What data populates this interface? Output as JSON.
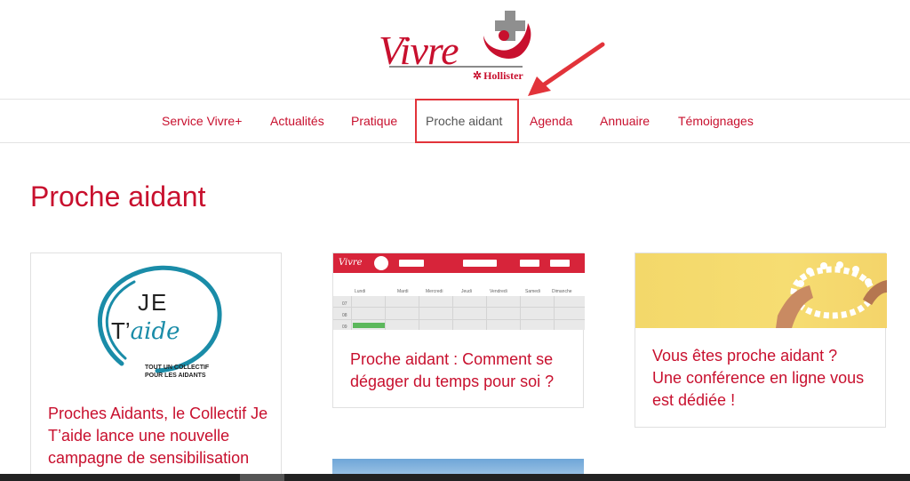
{
  "logo": {
    "text": "Vivre",
    "sub": "Hollister",
    "star": "✲"
  },
  "nav": {
    "items": [
      {
        "label": "Service Vivre+"
      },
      {
        "label": "Actualités"
      },
      {
        "label": "Pratique"
      },
      {
        "label": "Proche aidant"
      },
      {
        "label": "Agenda"
      },
      {
        "label": "Annuaire"
      },
      {
        "label": "Témoignages"
      }
    ],
    "active_index": 3
  },
  "page": {
    "title": "Proche aidant"
  },
  "cards": [
    {
      "title": "Proches Aidants, le Collectif Je T’aide lance une nouvelle campagne de sensibilisation",
      "image": {
        "je": "JE",
        "t": "T’",
        "aide": "aide",
        "tagline_1": "TOUT UN COLLECTIF",
        "tagline_2": "POUR LES AIDANTS"
      }
    },
    {
      "title": "Proche aidant : Comment se dégager du temps pour soi ?",
      "image": {
        "logo": "Vivre",
        "days": [
          "Lundi",
          "Mardi",
          "Mercredi",
          "Jeudi",
          "Vendredi",
          "Samedi",
          "Dimanche"
        ],
        "hours": [
          "07",
          "08",
          "09"
        ]
      }
    },
    {
      "title": "Vous êtes proche aidant ? Une conférence en ligne vous est dédiée !"
    }
  ],
  "colors": {
    "brand": "#c8102e",
    "annotation": "#e2333a",
    "nav_active": "#555555"
  }
}
